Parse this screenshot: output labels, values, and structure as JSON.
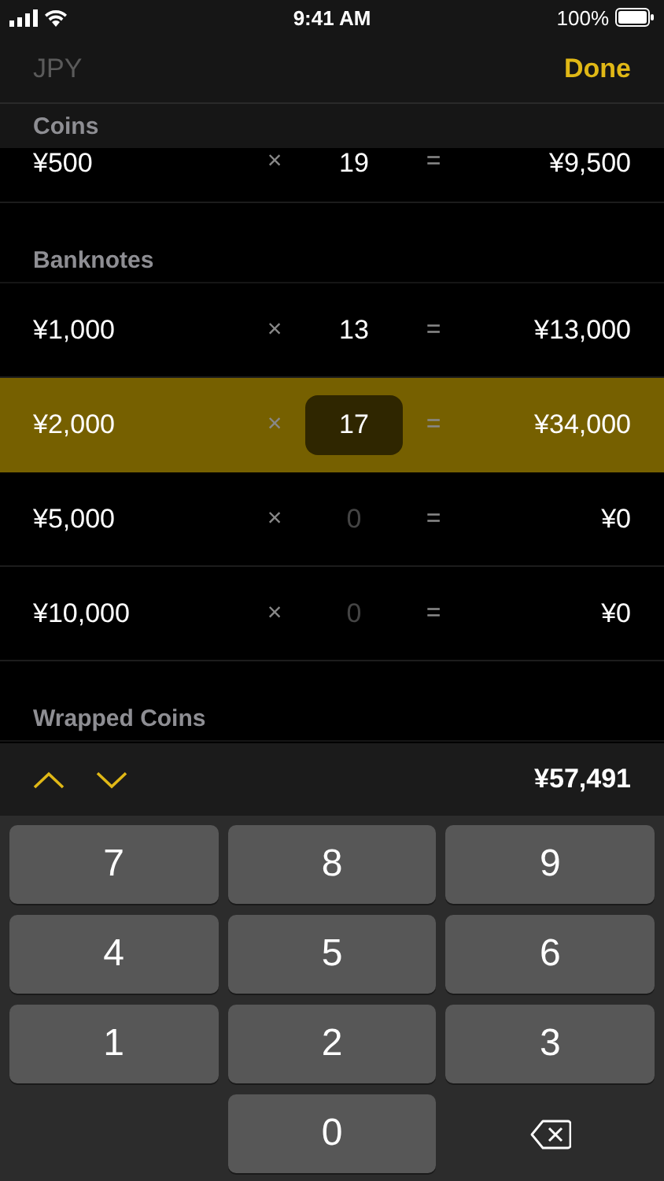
{
  "status_bar": {
    "time": "9:41 AM",
    "battery": "100%"
  },
  "nav": {
    "title": "JPY",
    "done": "Done"
  },
  "sections": [
    {
      "title": "Coins",
      "clipped": true,
      "rows": [
        {
          "denomination": "¥500",
          "times": "×",
          "count": "19",
          "muted": false,
          "equals": "=",
          "total": "¥9,500",
          "selected": false
        }
      ]
    },
    {
      "title": "Banknotes",
      "clipped": false,
      "rows": [
        {
          "denomination": "¥1,000",
          "times": "×",
          "count": "13",
          "muted": false,
          "equals": "=",
          "total": "¥13,000",
          "selected": false
        },
        {
          "denomination": "¥2,000",
          "times": "×",
          "count": "17",
          "muted": false,
          "equals": "=",
          "total": "¥34,000",
          "selected": true
        },
        {
          "denomination": "¥5,000",
          "times": "×",
          "count": "0",
          "muted": true,
          "equals": "=",
          "total": "¥0",
          "selected": false
        },
        {
          "denomination": "¥10,000",
          "times": "×",
          "count": "0",
          "muted": true,
          "equals": "=",
          "total": "¥0",
          "selected": false
        }
      ]
    },
    {
      "title": "Wrapped Coins",
      "clipped": false
    }
  ],
  "toolbar": {
    "total": "¥57,491"
  },
  "keypad": [
    {
      "kind": "digit",
      "label": "7"
    },
    {
      "kind": "digit",
      "label": "8"
    },
    {
      "kind": "digit",
      "label": "9"
    },
    {
      "kind": "digit",
      "label": "4"
    },
    {
      "kind": "digit",
      "label": "5"
    },
    {
      "kind": "digit",
      "label": "6"
    },
    {
      "kind": "digit",
      "label": "1"
    },
    {
      "kind": "digit",
      "label": "2"
    },
    {
      "kind": "digit",
      "label": "3"
    },
    {
      "kind": "blank"
    },
    {
      "kind": "digit",
      "label": "0"
    },
    {
      "kind": "delete"
    }
  ]
}
